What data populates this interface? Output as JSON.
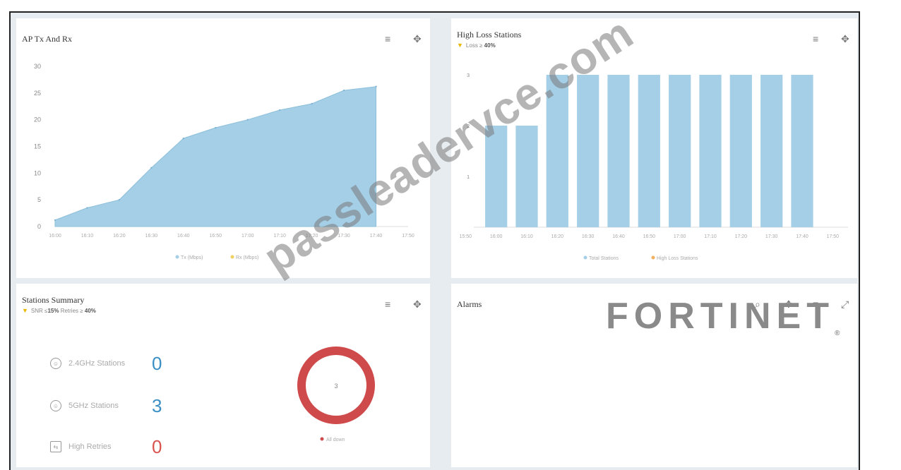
{
  "panels": {
    "tx_rx": {
      "title": "AP Tx And Rx",
      "menu_icon": "≡",
      "move_icon": "✥"
    },
    "high_loss": {
      "title": "High Loss Stations",
      "filter_prefix": "Loss ≥",
      "filter_value": "40%",
      "menu_icon": "≡",
      "move_icon": "✥"
    },
    "stations_summary": {
      "title": "Stations Summary",
      "filter_prefix": "SNR ≤",
      "filter_snr": "15%",
      "filter_mid": "Retries ≥",
      "filter_retries": "40%",
      "menu_icon": "≡",
      "move_icon": "✥",
      "stats": [
        {
          "icon": "2.4ghz-stations-icon",
          "glyph": "☺",
          "label": "2.4GHz Stations",
          "value": "0",
          "color": "#3a8fc4"
        },
        {
          "icon": "5ghz-stations-icon",
          "glyph": "☺",
          "label": "5GHz Stations",
          "value": "3",
          "color": "#3a8fc4"
        },
        {
          "icon": "high-retries-icon",
          "glyph": "⇆",
          "label": "High Retries",
          "value": "0",
          "color": "#d9534f"
        }
      ],
      "donut_center": "3",
      "donut_legend": "All down",
      "donut_color": "#d04545"
    },
    "alarms": {
      "title": "Alarms",
      "search_icon": "⌕",
      "move_icon": "✥",
      "menu_icon": "≡",
      "expand_icon": "⤢"
    }
  },
  "watermark": "passleadervce.com",
  "logo": {
    "text": "FORTINET",
    "reg": "®"
  },
  "chart_data": [
    {
      "type": "area",
      "title": "AP Tx And Rx",
      "x": [
        "16:00",
        "16:10",
        "16:20",
        "16:30",
        "16:40",
        "16:50",
        "17:00",
        "17:10",
        "17:20",
        "17:30",
        "17:40",
        "17:50"
      ],
      "series": [
        {
          "name": "Tx (Mbps)",
          "color": "#a4cfe6",
          "values": [
            1.2,
            3.5,
            5.0,
            11.0,
            16.5,
            18.5,
            20.0,
            21.8,
            23.0,
            25.5,
            26.2,
            null
          ]
        },
        {
          "name": "Rx (Mbps)",
          "color": "#f0d060",
          "values": []
        }
      ],
      "ylim": [
        0,
        30
      ],
      "yticks": [
        0,
        5,
        10,
        15,
        20,
        25,
        30
      ],
      "legend": "bottom"
    },
    {
      "type": "bar",
      "title": "High Loss Stations",
      "x": [
        "15:50",
        "16:00",
        "16:10",
        "16:20",
        "16:30",
        "16:40",
        "16:50",
        "17:00",
        "17:10",
        "17:20",
        "17:30",
        "17:40",
        "17:50"
      ],
      "series": [
        {
          "name": "Total Stations",
          "color": "#a4cfe6",
          "values": [
            null,
            2,
            2,
            3,
            3,
            3,
            3,
            3,
            3,
            3,
            3,
            3,
            null
          ]
        },
        {
          "name": "High Loss Stations",
          "color": "#f0b060",
          "values": []
        }
      ],
      "ylim": [
        0,
        3
      ],
      "yticks": [
        1,
        2,
        3
      ],
      "legend": "bottom"
    }
  ]
}
